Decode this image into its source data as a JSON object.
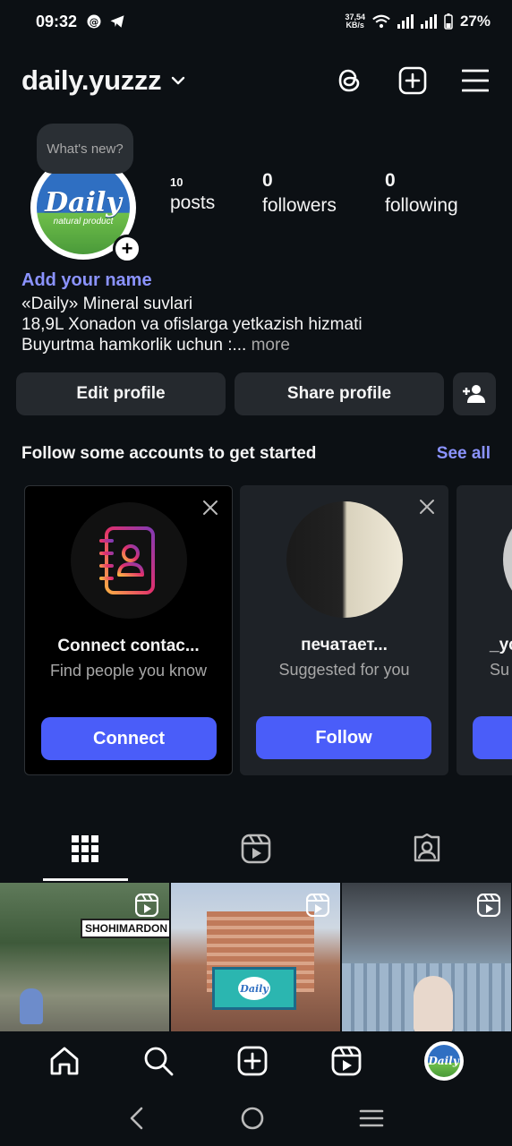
{
  "status_bar": {
    "time": "09:32",
    "net_speed_value": "37,54",
    "net_speed_unit": "KB/s",
    "battery": "27%"
  },
  "header": {
    "username": "daily.yuzzz"
  },
  "profile": {
    "note_bubble": "What's new?",
    "logo_word": "Daily",
    "logo_sub": "natural product",
    "stats": {
      "posts_value": "10",
      "posts_label": "posts",
      "followers_value": "0",
      "followers_label": "followers",
      "following_value": "0",
      "following_label": "following"
    },
    "add_name": "Add your name",
    "bio_line1": "«Daily» Mineral suvlari",
    "bio_line2": "18,9L Xonadon va ofislarga yetkazish hizmati",
    "bio_line3": "Buyurtma hamkorlik uchun :...",
    "bio_more": "more",
    "edit_profile": "Edit profile",
    "share_profile": "Share profile"
  },
  "suggestions": {
    "heading": "Follow some accounts to get started",
    "see_all": "See all",
    "cards": [
      {
        "title": "Connect contac...",
        "subtitle": "Find people you know",
        "button": "Connect"
      },
      {
        "title": "печатает...",
        "subtitle": "Suggested for you",
        "button": "Follow"
      },
      {
        "title": "_yc",
        "subtitle": "Su",
        "button": ""
      }
    ]
  },
  "grid": {
    "tiles": [
      {
        "sign_text": "SHOHIMARDON"
      },
      {
        "sign_text": "Daily"
      },
      {
        "sign_text": ""
      }
    ]
  },
  "bottom_nav": {
    "avatar_text": "Daily"
  },
  "colors": {
    "background": "#0c1014",
    "accent_link": "#8b93ff",
    "primary_button": "#4a5df9",
    "secondary_button": "#25292e"
  }
}
